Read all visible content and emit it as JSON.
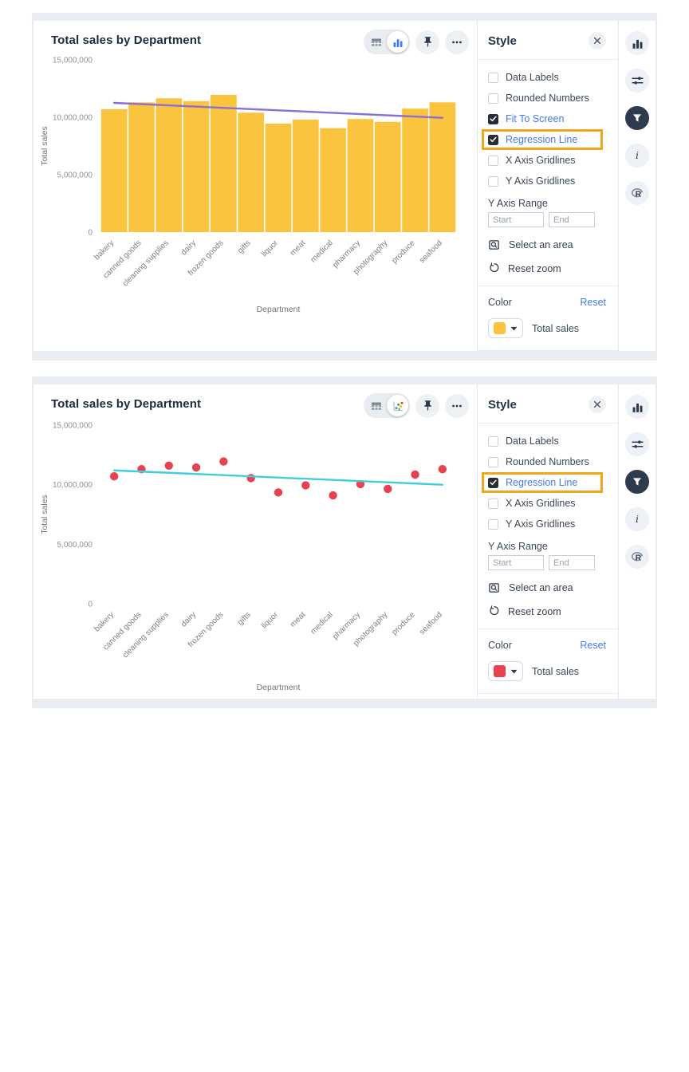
{
  "colors": {
    "accent_blue": "#3F7BEA",
    "highlight_orange": "#F2A61C",
    "dark_navy": "#2E3B4E",
    "bar_yellow": "#FAC43E",
    "dot_red": "#E84150",
    "regression_purple": "#8A6FD6",
    "regression_cyan": "#3FCEE0"
  },
  "icon_strip": [
    {
      "name": "bar-chart-icon",
      "filled": false
    },
    {
      "name": "sliders-icon",
      "filled": false
    },
    {
      "name": "filter-icon",
      "filled": true
    },
    {
      "name": "info-icon",
      "filled": false
    },
    {
      "name": "r-logo-icon",
      "filled": false
    }
  ],
  "panels": [
    {
      "title": "Total sales by Department",
      "toolbar": {
        "chart_type_toggle": [
          {
            "icon": "table-icon",
            "selected": false
          },
          {
            "icon": "bar-chart-icon",
            "selected": true
          }
        ]
      },
      "style_panel": {
        "title": "Style",
        "options": [
          {
            "label": "Data Labels",
            "checked": false,
            "highlighted": false
          },
          {
            "label": "Rounded Numbers",
            "checked": false,
            "highlighted": false
          },
          {
            "label": "Fit To Screen",
            "checked": true,
            "highlighted": false
          },
          {
            "label": "Regression Line",
            "checked": true,
            "highlighted": true
          },
          {
            "label": "X Axis Gridlines",
            "checked": false,
            "highlighted": false
          },
          {
            "label": "Y Axis Gridlines",
            "checked": false,
            "highlighted": false
          }
        ],
        "y_axis_range_label": "Y Axis Range",
        "start_placeholder": "Start",
        "end_placeholder": "End",
        "select_area_label": "Select an area",
        "reset_zoom_label": "Reset zoom",
        "color_label": "Color",
        "color_reset_label": "Reset",
        "series_label": "Total sales",
        "swatch_color": "#FAC43E"
      },
      "chart_data": {
        "type": "bar",
        "title": "Total sales by Department",
        "xlabel": "Department",
        "ylabel": "Total sales",
        "ylim": [
          0,
          15000000
        ],
        "yticks": [
          0,
          5000000,
          10000000,
          15000000
        ],
        "grid": false,
        "categories": [
          "bakery",
          "canned goods",
          "cleaning supplies",
          "dairy",
          "frozen goods",
          "gifts",
          "liquor",
          "meat",
          "medical",
          "pharmacy",
          "photography",
          "produce",
          "seafood"
        ],
        "values": [
          10700000,
          11300000,
          11650000,
          11400000,
          11950000,
          10400000,
          9450000,
          9800000,
          9050000,
          9850000,
          9600000,
          10750000,
          11300000
        ],
        "series_color": "#FAC43E",
        "regression_line": {
          "start": 11250000,
          "end": 9950000,
          "color": "#8A6FD6"
        }
      }
    },
    {
      "title": "Total sales by Department",
      "toolbar": {
        "chart_type_toggle": [
          {
            "icon": "table-icon",
            "selected": false
          },
          {
            "icon": "scatter-chart-icon",
            "selected": true
          }
        ]
      },
      "style_panel": {
        "title": "Style",
        "options": [
          {
            "label": "Data Labels",
            "checked": false,
            "highlighted": false
          },
          {
            "label": "Rounded Numbers",
            "checked": false,
            "highlighted": false
          },
          {
            "label": "Regression Line",
            "checked": true,
            "highlighted": true
          },
          {
            "label": "X Axis Gridlines",
            "checked": false,
            "highlighted": false
          },
          {
            "label": "Y Axis Gridlines",
            "checked": false,
            "highlighted": false
          }
        ],
        "y_axis_range_label": "Y Axis Range",
        "start_placeholder": "Start",
        "end_placeholder": "End",
        "select_area_label": "Select an area",
        "reset_zoom_label": "Reset zoom",
        "color_label": "Color",
        "color_reset_label": "Reset",
        "series_label": "Total sales",
        "swatch_color": "#E84150"
      },
      "chart_data": {
        "type": "scatter",
        "title": "Total sales by Department",
        "xlabel": "Department",
        "ylabel": "Total sales",
        "ylim": [
          0,
          15000000
        ],
        "yticks": [
          0,
          5000000,
          10000000,
          15000000
        ],
        "grid": false,
        "categories": [
          "bakery",
          "canned goods",
          "cleaning supplies",
          "dairy",
          "frozen goods",
          "gifts",
          "liquor",
          "meat",
          "medical",
          "pharmacy",
          "photography",
          "produce",
          "seafood"
        ],
        "values": [
          10700000,
          11300000,
          11600000,
          11450000,
          11950000,
          10550000,
          9350000,
          9950000,
          9100000,
          10050000,
          9650000,
          10850000,
          11300000
        ],
        "series_color": "#E84150",
        "regression_line": {
          "start": 11200000,
          "end": 10000000,
          "color": "#3FCEE0"
        }
      }
    }
  ]
}
